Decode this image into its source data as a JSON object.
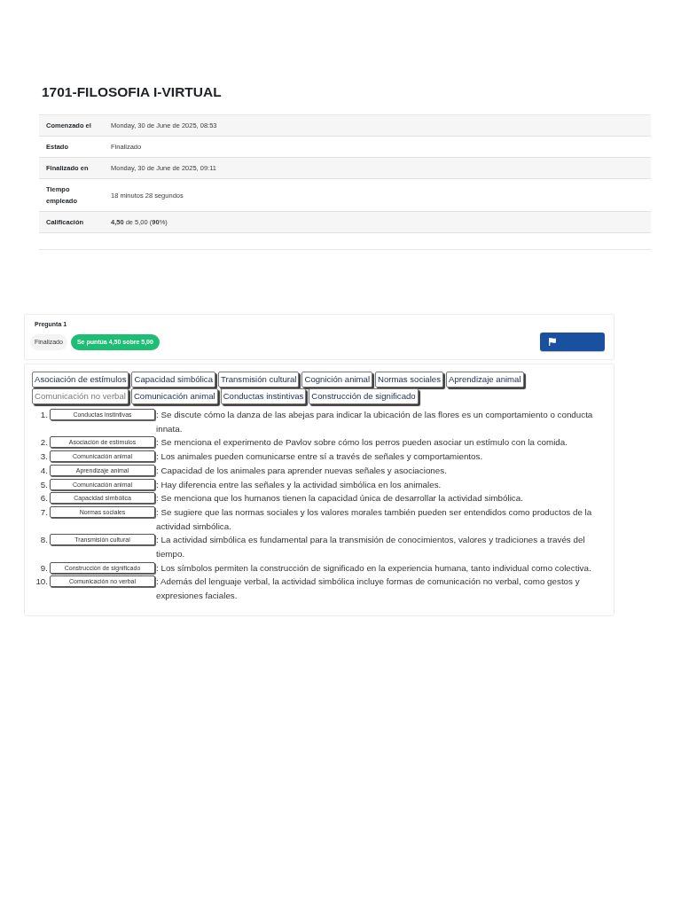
{
  "quiz": {
    "title": "1701-FILOSOFIA I-VIRTUAL",
    "summary": [
      {
        "label": "Comenzado el",
        "value": "Monday, 30 de June de 2025, 08:53"
      },
      {
        "label": "Estado",
        "value": "Finalizado"
      },
      {
        "label": "Finalizado en",
        "value": "Monday, 30 de June de 2025, 09:11"
      },
      {
        "label": "Tiempo empleado",
        "value": "18 minutos 28 segundos"
      },
      {
        "label": "Calificación",
        "value": "**4,50** de 5,00 (**90**%)"
      }
    ]
  },
  "question": {
    "label": "Pregunta 1",
    "state": "Finalizado",
    "grade": "Se puntúa 4,50 sobre 5,00"
  },
  "chips": [
    {
      "label": "Asociación de estímulos",
      "disabled": false
    },
    {
      "label": "Capacidad simbólica",
      "disabled": false
    },
    {
      "label": "Transmisión cultural",
      "disabled": false
    },
    {
      "label": "Cognición animal",
      "disabled": false
    },
    {
      "label": "Normas sociales",
      "disabled": false
    },
    {
      "label": "Aprendizaje animal",
      "disabled": false
    },
    {
      "label": "Comunicación no verbal",
      "disabled": true
    },
    {
      "label": "Comunicación animal",
      "disabled": false
    },
    {
      "label": "Conductas instintivas",
      "disabled": false
    },
    {
      "label": "Construcción de significado",
      "disabled": false
    }
  ],
  "items": [
    {
      "number": "1.",
      "answer": "Conductas instintivas",
      "text": ": Se discute cómo la danza de las abejas para indicar la ubicación de las flores es un comportamiento o conducta innata."
    },
    {
      "number": "2.",
      "answer": "Asociación de estímulos",
      "text": ": Se menciona el experimento de Pavlov sobre cómo los perros pueden asociar un estímulo con la comida."
    },
    {
      "number": "3.",
      "answer": "Comunicación animal",
      "text": ": Los animales pueden comunicarse entre sí a través de señales y comportamientos."
    },
    {
      "number": "4.",
      "answer": "Aprendizaje animal",
      "text": ": Capacidad de los animales para aprender nuevas señales y asociaciones."
    },
    {
      "number": "5.",
      "answer": "Comunicación animal",
      "text": ": Hay diferencia entre las señales y la actividad simbólica en los animales."
    },
    {
      "number": "6.",
      "answer": "Capacidad simbólica",
      "text": ": Se menciona que los humanos tienen la capacidad única de desarrollar la actividad simbólica."
    },
    {
      "number": "7.",
      "answer": "Normas sociales",
      "text": ": Se sugiere que las normas sociales y los valores morales también pueden ser entendidos como productos de la actividad simbólica."
    },
    {
      "number": "8.",
      "answer": "Transmisión cultural",
      "text": ": La actividad simbólica es fundamental para la transmisión de conocimientos, valores y tradiciones a través del tiempo."
    },
    {
      "number": "9.",
      "answer": "Construcción de significado",
      "text": ": Los símbolos permiten la construcción de significado en la experiencia humana, tanto individual como colectiva."
    },
    {
      "number": "10.",
      "answer": "Comunicación no verbal",
      "text": ": Además del lenguaje verbal, la actividad simbólica incluye formas de comunicación no verbal, como gestos y expresiones faciales."
    }
  ]
}
